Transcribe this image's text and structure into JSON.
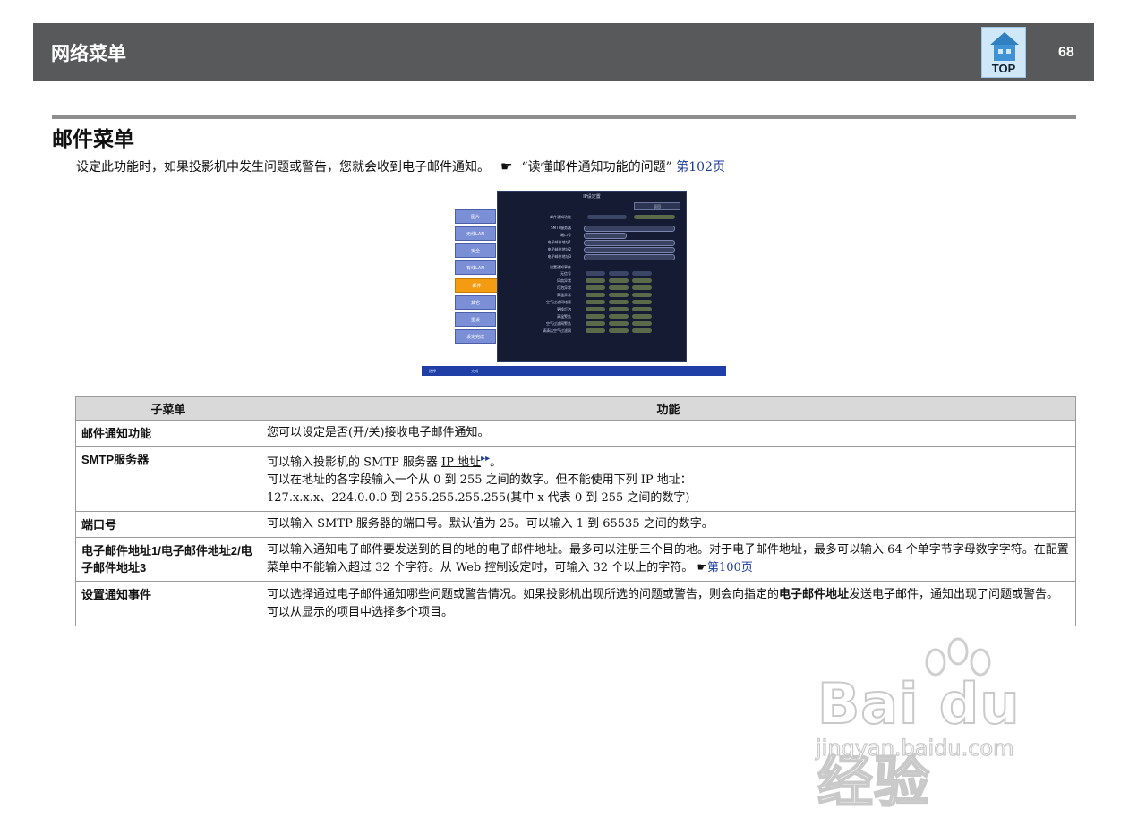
{
  "header": {
    "title": "网络菜单",
    "top_label": "TOP",
    "page_number": "68"
  },
  "section": {
    "title": "邮件菜单",
    "intro_text": "设定此功能时，如果投影机中发生问题或警告，您就会收到电子邮件通知。",
    "intro_hand": "☛",
    "intro_ref": "“读懂邮件通知功能的问题”",
    "intro_link": "第102页"
  },
  "projector_menu": {
    "title": "IP设定置",
    "return_label": "返回",
    "side_items": [
      "图片",
      "无线LAN",
      "安全",
      "有线LAN",
      "邮件",
      "其它",
      "重设",
      "设定完成"
    ],
    "active_index": 4,
    "rows": [
      "邮件通知功能",
      "SMTP服务器",
      "端口号",
      "电子邮件地址1",
      "电子邮件地址2",
      "电子邮件地址3",
      "设置通知事件",
      "无信号",
      "风扇异常",
      "灯泡异常",
      "高温异常",
      "空气过滤网堵塞",
      "更换灯泡",
      "高温警告",
      "空气过滤网警告",
      "请清洁空气过滤网"
    ],
    "status_left": "选择",
    "status_right": "完成"
  },
  "table": {
    "headers": [
      "子菜单",
      "功能"
    ],
    "rows": [
      {
        "name": "邮件通知功能",
        "desc": "您可以设定是否(开/关)接收电子邮件通知。"
      },
      {
        "name": "SMTP服务器",
        "desc1a": "可以输入投影机的 SMTP 服务器 ",
        "desc1_link": "IP 地址",
        "desc1_arrow": "▸▸",
        "desc1b": "。",
        "desc2": "可以在地址的各字段输入一个从 0 到 255 之间的数字。但不能使用下列 IP 地址：",
        "desc3": "127.x.x.x、224.0.0.0 到 255.255.255.255(其中 x 代表 0 到 255 之间的数字)"
      },
      {
        "name": "端口号",
        "desc": "可以输入 SMTP 服务器的端口号。默认值为 25。可以输入 1 到 65535 之间的数字。"
      },
      {
        "name": "电子邮件地址1/电子邮件地址2/电子邮件地址3",
        "desc": "可以输入通知电子邮件要发送到的目的地的电子邮件地址。最多可以注册三个目的地。对于电子邮件地址，最多可以输入 64 个单字节字母数字字符。在配置菜单中不能输入超过 32 个字符。从 Web 控制设定时，可输入 32 个以上的字符。",
        "hand": "☛",
        "link": "第100页"
      },
      {
        "name": "设置通知事件",
        "desc_a": "可以选择通过电子邮件通知哪些问题或警告情况。如果投影机出现所选的问题或警告，则会向指定的",
        "desc_bold": "电子邮件地址",
        "desc_b": "发送电子邮件，通知出现了问题或警告。可以从显示的项目中选择多个项目。"
      }
    ]
  },
  "watermark": {
    "main": "Bai du 经验",
    "sub": "jingyan.baidu.com"
  }
}
